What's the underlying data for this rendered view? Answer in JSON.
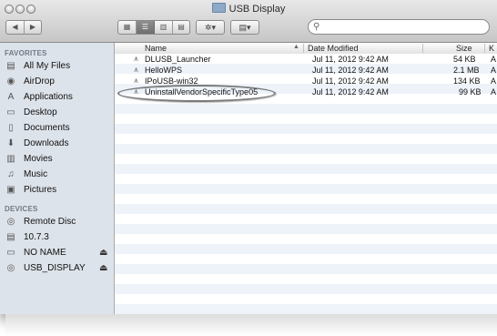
{
  "window": {
    "title": "USB Display"
  },
  "toolbar": {
    "back_icon": "chevron-left-icon",
    "forward_icon": "chevron-right-icon",
    "view_icons": [
      "icon-view-icon",
      "list-view-icon",
      "column-view-icon",
      "cover-flow-icon"
    ],
    "action_icon": "gear-icon",
    "arrange_icon": "arrange-icon",
    "search_placeholder": ""
  },
  "sidebar": {
    "favorites_heading": "FAVORITES",
    "favorites": [
      {
        "label": "All My Files",
        "icon": "files-icon"
      },
      {
        "label": "AirDrop",
        "icon": "airdrop-icon"
      },
      {
        "label": "Applications",
        "icon": "applications-icon"
      },
      {
        "label": "Desktop",
        "icon": "desktop-icon"
      },
      {
        "label": "Documents",
        "icon": "documents-icon"
      },
      {
        "label": "Downloads",
        "icon": "downloads-icon"
      },
      {
        "label": "Movies",
        "icon": "movies-icon"
      },
      {
        "label": "Music",
        "icon": "music-icon"
      },
      {
        "label": "Pictures",
        "icon": "pictures-icon"
      }
    ],
    "devices_heading": "DEVICES",
    "devices": [
      {
        "label": "Remote Disc",
        "icon": "disc-icon",
        "eject": false
      },
      {
        "label": "10.7.3",
        "icon": "disk-icon",
        "eject": false
      },
      {
        "label": "NO NAME",
        "icon": "drive-icon",
        "eject": true
      },
      {
        "label": "USB_DISPLAY",
        "icon": "disc-icon",
        "eject": true
      }
    ]
  },
  "columns": {
    "name": "Name",
    "date": "Date Modified",
    "size": "Size",
    "kind": "K"
  },
  "files": [
    {
      "name": "DLUSB_Launcher",
      "date": "Jul 11, 2012 9:42 AM",
      "size": "54 KB",
      "kind": "A"
    },
    {
      "name": "HelloWPS",
      "date": "Jul 11, 2012 9:42 AM",
      "size": "2.1 MB",
      "kind": "A"
    },
    {
      "name": "IPoUSB-win32",
      "date": "Jul 11, 2012 9:42 AM",
      "size": "134 KB",
      "kind": "A"
    },
    {
      "name": "UninstallVendorSpecificType05",
      "date": "Jul 11, 2012 9:42 AM",
      "size": "99 KB",
      "kind": "A"
    }
  ],
  "colors": {
    "sidebar_bg": "#dde3ea",
    "row_stripe": "#eef3fa",
    "highlight_oval": "#7a7a7a"
  }
}
